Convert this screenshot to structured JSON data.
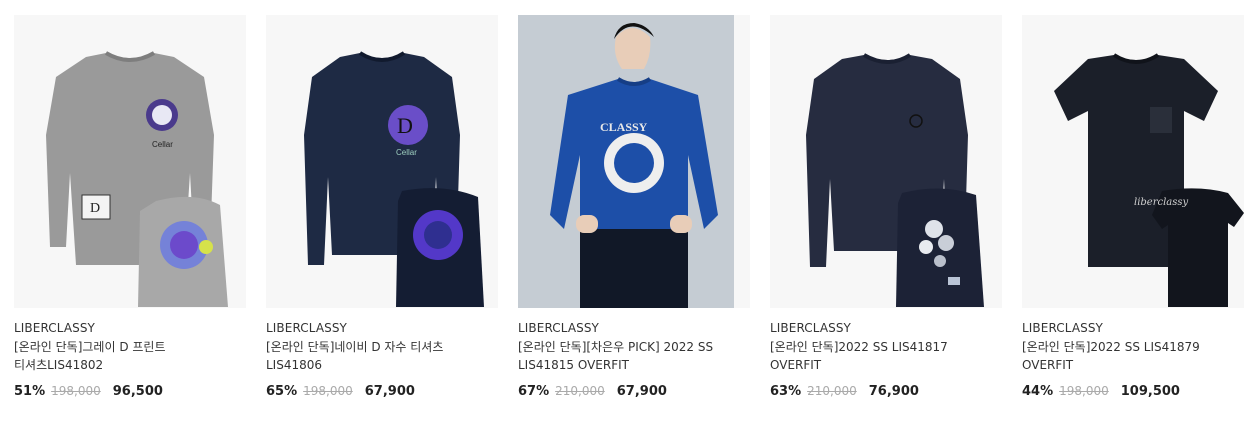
{
  "products": [
    {
      "brand": "LIBERCLASSY",
      "title": "[온라인 단독]그레이 D 프린트 티셔츠LIS41802",
      "discount": "51%",
      "original_price": "198,000",
      "sale_price": "96,500",
      "image_icon": "gray-sweatshirt-image"
    },
    {
      "brand": "LIBERCLASSY",
      "title": "[온라인 단독]네이비 D 자수 티셔츠 LIS41806",
      "discount": "65%",
      "original_price": "198,000",
      "sale_price": "67,900",
      "image_icon": "navy-sweatshirt-image"
    },
    {
      "brand": "LIBERCLASSY",
      "title": "[온라인 단독][차은우 PICK] 2022 SS LIS41815 OVERFIT",
      "discount": "67%",
      "original_price": "210,000",
      "sale_price": "67,900",
      "image_icon": "model-blue-sweatshirt-image"
    },
    {
      "brand": "LIBERCLASSY",
      "title": "[온라인 단독]2022 SS LIS41817 OVERFIT",
      "discount": "63%",
      "original_price": "210,000",
      "sale_price": "76,900",
      "image_icon": "navy-floral-sweatshirt-image"
    },
    {
      "brand": "LIBERCLASSY",
      "title": "[온라인 단독]2022 SS LIS41879 OVERFIT",
      "discount": "44%",
      "original_price": "198,000",
      "sale_price": "109,500",
      "image_icon": "black-tshirt-image"
    }
  ],
  "colors": {
    "card_bg": "#f7f7f7",
    "photo_bg": "#c5ccd3",
    "text": "#333333",
    "strike": "#aaaaaa"
  }
}
